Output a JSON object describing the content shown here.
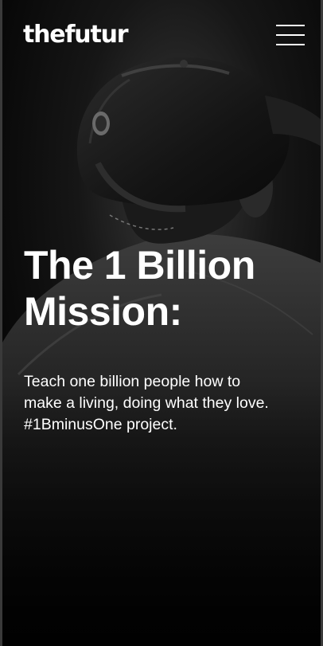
{
  "brand": {
    "logo_text": "thefutur"
  },
  "header": {
    "menu_icon": "hamburger-menu-icon"
  },
  "hero": {
    "background_image": "black-and-white photo of a person wearing a cap, seen from behind",
    "headline_lines": [
      "The 1 Billion",
      "Mission:"
    ],
    "tagline_lines": [
      "Teach one billion people how to",
      "make a living, doing what they love.",
      "#1BminusOne project."
    ]
  },
  "colors": {
    "background": "#050505",
    "text": "#ffffff",
    "frame": "#3a3a3a"
  }
}
